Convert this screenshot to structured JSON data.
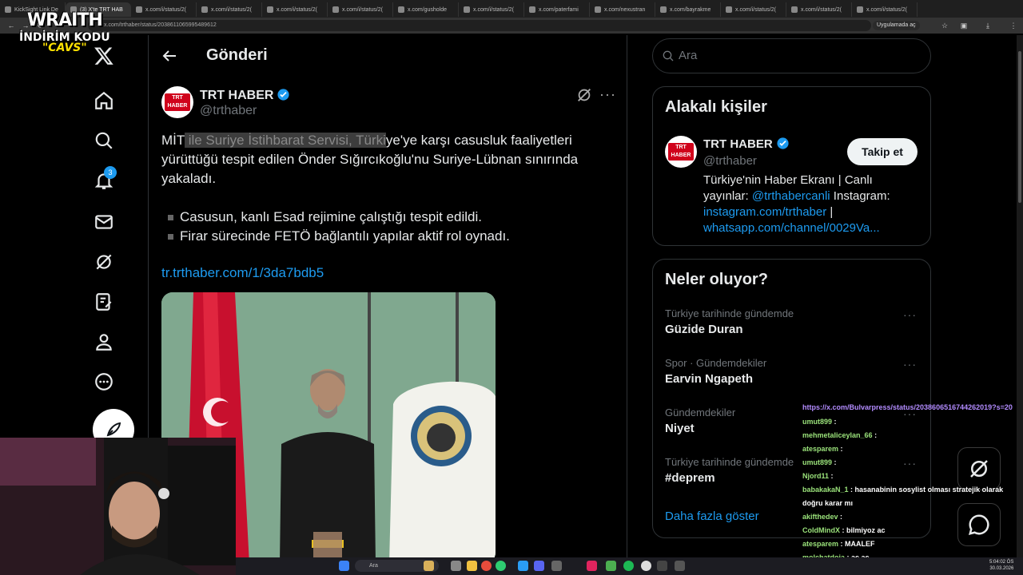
{
  "browser": {
    "tabs": [
      {
        "label": "KickSight Link De"
      },
      {
        "label": "(3) X'te TRT HAB"
      },
      {
        "label": "x.com/i/status/2("
      },
      {
        "label": "x.com/i/status/2("
      },
      {
        "label": "x.com/i/status/2("
      },
      {
        "label": "x.com/i/status/2("
      },
      {
        "label": "x.com/gusholde"
      },
      {
        "label": "x.com/i/status/2("
      },
      {
        "label": "x.com/paterfami"
      },
      {
        "label": "x.com/nexustran"
      },
      {
        "label": "x.com/bayrakme"
      },
      {
        "label": "x.com/i/status/2("
      },
      {
        "label": "x.com/i/status/2("
      },
      {
        "label": "x.com/i/status/2("
      }
    ],
    "url": "x.com/trthaber/status/2038611065995489612",
    "app_button": "Uygulamada aç"
  },
  "overlay": {
    "line1": "WRAITH",
    "line2": "İNDİRİM KODU",
    "line3": "\"CAVS\""
  },
  "nav": {
    "notif_count": "3"
  },
  "header": {
    "title": "Gönderi"
  },
  "tweet": {
    "name": "TRT HABER",
    "handle": "@trthaber",
    "avatar_line1": "TRT",
    "avatar_line2": "HABER",
    "text_pre": "MİT",
    "text_hl": " ile Suriye İstihbarat Servisi, Türki",
    "text_post": "ye'ye karşı casusluk faaliyetleri yürüttüğü tespit edilen Önder Sığırcıkoğlu'nu Suriye-Lübnan sınırında yakaladı.",
    "bullet1": "Casusun, kanlı Esad rejimine çalıştığı tespit edildi.",
    "bullet2": "Firar sürecinde FETÖ bağlantılı yapılar aktif rol oynadı.",
    "link": "tr.trthaber.com/1/3da7bdb5",
    "seal_text": "İSTİHBARAT TEŞKİLATI"
  },
  "right": {
    "search_placeholder": "Ara",
    "people_title": "Alakalı kişiler",
    "person_name": "TRT HABER",
    "person_handle": "@trthaber",
    "follow_label": "Takip et",
    "bio_text1": "Türkiye'nin Haber Ekranı | Canlı yayınlar: ",
    "bio_link1": "@trthabercanli",
    "bio_text2": " Instagram: ",
    "bio_link2": "instagram.com/trthaber",
    "bio_text3": " |",
    "bio_link3": "whatsapp.com/channel/0029Va...",
    "trends_title": "Neler oluyor?",
    "trends": [
      {
        "context": "Türkiye tarihinde gündemde",
        "name": "Güzide Duran"
      },
      {
        "context": "Spor · Gündemdekiler",
        "name": "Earvin Ngapeth"
      },
      {
        "context": "Gündemdekiler",
        "name": "Niyet"
      },
      {
        "context": "Türkiye tarihinde gündemde",
        "name": "#deprem"
      }
    ],
    "show_more": "Daha fazla göster"
  },
  "chat": {
    "link": "https://x.com/Bulvarpress/status/2038606516744262019?s=20",
    "messages": [
      {
        "user": "umut899",
        "text": ""
      },
      {
        "user": "mehmetaliceylan_66",
        "text": ""
      },
      {
        "user": "atesparem",
        "text": ""
      },
      {
        "user": "umut899",
        "text": ""
      },
      {
        "user": "Njord11",
        "text": ""
      },
      {
        "user": "babakakaN_1",
        "text": "hasanabinin sosylist olması stratejik olarak doğru karar mı"
      },
      {
        "user": "akifthedev",
        "text": ""
      },
      {
        "user": "ColdMindX",
        "text": "bilmiyoz ac"
      },
      {
        "user": "atesparem",
        "text": "MAALEF"
      },
      {
        "user": "molchatdoja",
        "text": "aç aç"
      }
    ]
  },
  "taskbar": {
    "search": "Ara",
    "time": "5:04:02 ÖS",
    "date": "30.03.2026"
  },
  "colors": {
    "accent": "#1d9bf0",
    "verified": "#1d9bf0",
    "trt_red": "#d0021b"
  }
}
